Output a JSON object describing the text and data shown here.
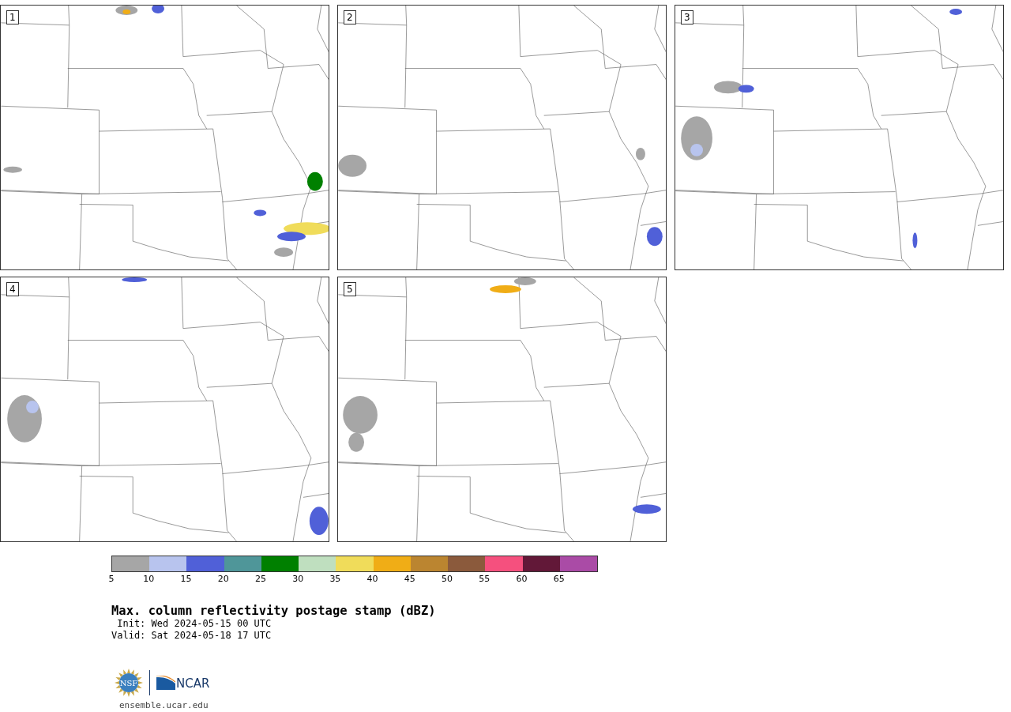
{
  "panels": [
    {
      "label": "1"
    },
    {
      "label": "2"
    },
    {
      "label": "3"
    },
    {
      "label": "4"
    },
    {
      "label": "5"
    }
  ],
  "colorbar": {
    "colors": [
      {
        "color": "#a6a6a6"
      },
      {
        "color": "#b8c4ee"
      },
      {
        "color": "#5060d8"
      },
      {
        "color": "#4f9699"
      },
      {
        "color": "#008000"
      },
      {
        "color": "#bfdfbf"
      },
      {
        "color": "#f0dc5a"
      },
      {
        "color": "#f0ad16"
      },
      {
        "color": "#bb8530"
      },
      {
        "color": "#8b5a3c"
      },
      {
        "color": "#f5507e"
      },
      {
        "color": "#621838"
      },
      {
        "color": "#aa4ba6"
      }
    ],
    "ticks": [
      "5",
      "10",
      "15",
      "20",
      "25",
      "30",
      "35",
      "40",
      "45",
      "50",
      "55",
      "60",
      "65"
    ]
  },
  "title": "Max. column reflectivity postage stamp (dBZ)",
  "init": " Init: Wed 2024-05-15 00 UTC",
  "valid": "Valid: Sat 2024-05-18 17 UTC",
  "logos": {
    "nsf": "NSF",
    "ncar": "NCAR"
  },
  "url": "ensemble.ucar.edu"
}
